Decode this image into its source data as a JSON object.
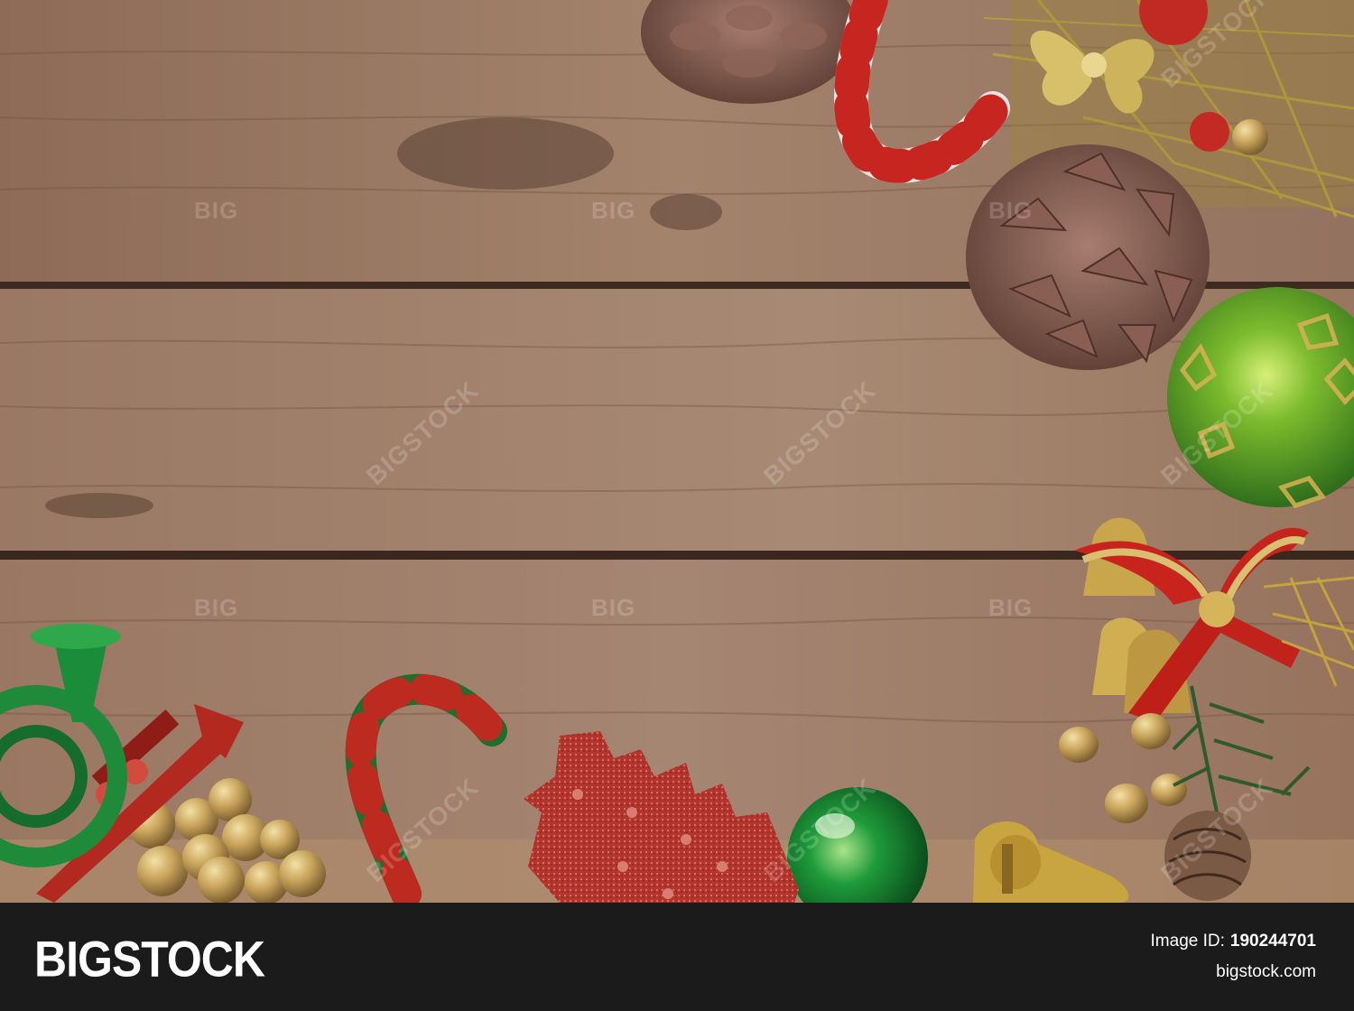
{
  "photo": {
    "description_icon": "christmas-decorations-photo",
    "colors": {
      "wood_light": "#9c7a63",
      "wood_dark": "#6e5242",
      "gap": "#3d2b22",
      "green_ornament": "#6fae2c",
      "red_accent": "#b8271f",
      "gold": "#c9a24a"
    },
    "watermarks": [
      "BIG",
      "BIGSTOCK"
    ]
  },
  "footer": {
    "brand": "BIGSTOCK",
    "image_id_label": "Image ID:",
    "image_id": "190244701",
    "site": "bigstock.com"
  }
}
